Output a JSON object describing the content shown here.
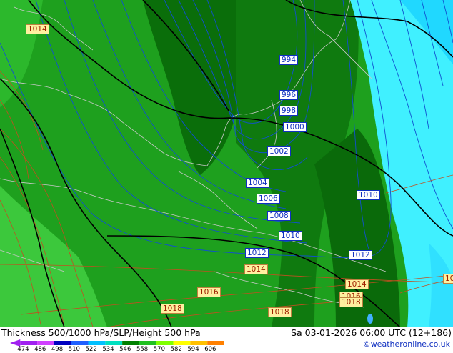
{
  "title": "Thickness 500/1000 hPa/SLP/Height 500 hPa",
  "date": "Sa 03-01-2026 06:00 UTC (12+186)",
  "credit": "©weatheronline.co.uk",
  "colors": {
    "land_green": "#1ea01e",
    "dark_green": "#0a6e0a",
    "light_green": "#3cc83c",
    "cyan": "#40f0ff",
    "isobar": "#1050d0",
    "thickness": "#c05020",
    "height": "#000000"
  },
  "isobar_labels": [
    "1014",
    "994",
    "996",
    "998",
    "1000",
    "1002",
    "1004",
    "1006",
    "1008",
    "1010",
    "1010",
    "1012",
    "1012",
    "1014",
    "1014",
    "1016",
    "1018",
    "1018",
    "1016",
    "1018",
    "10"
  ],
  "scale": {
    "ticks": [
      "474",
      "486",
      "498",
      "510",
      "522",
      "534",
      "546",
      "558",
      "570",
      "582",
      "594",
      "606"
    ],
    "colors": [
      "#a020f0",
      "#d040ff",
      "#0000c0",
      "#2060ff",
      "#00c0ff",
      "#00e0c0",
      "#008000",
      "#20c020",
      "#80ff00",
      "#ffff00",
      "#ffc000",
      "#ff8000"
    ]
  }
}
